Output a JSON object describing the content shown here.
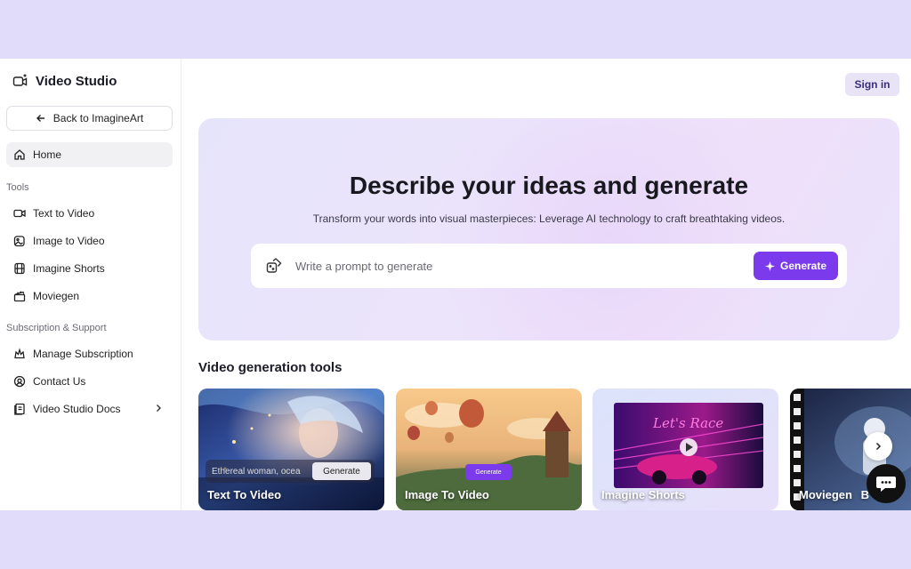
{
  "sidebar": {
    "brand": "Video Studio",
    "back_label": "Back to ImagineArt",
    "home_label": "Home",
    "tools_heading": "Tools",
    "tools": [
      {
        "label": "Text to Video",
        "icon": "video-camera-icon"
      },
      {
        "label": "Image to Video",
        "icon": "image-sparkle-icon"
      },
      {
        "label": "Imagine Shorts",
        "icon": "film-icon"
      },
      {
        "label": "Moviegen",
        "icon": "clapperboard-icon"
      }
    ],
    "support_heading": "Subscription & Support",
    "support": [
      {
        "label": "Manage Subscription",
        "icon": "crown-icon"
      },
      {
        "label": "Contact Us",
        "icon": "at-sign-icon"
      },
      {
        "label": "Video Studio Docs",
        "icon": "docs-icon"
      }
    ]
  },
  "header": {
    "signin_label": "Sign in"
  },
  "hero": {
    "title": "Describe your ideas and generate",
    "subtitle": "Transform your words into visual masterpieces: Leverage AI technology to craft breathtaking videos.",
    "prompt_placeholder": "Write a prompt to generate",
    "generate_label": "Generate"
  },
  "tools_section": {
    "title": "Video generation tools",
    "cards": [
      {
        "label": "Text To Video",
        "mini_prompt": "Ethereal woman, ocea",
        "mini_button": "Generate"
      },
      {
        "label": "Image To Video",
        "mini_button": "Generate"
      },
      {
        "label": "Imagine Shorts",
        "sign_text": "Let's Race"
      },
      {
        "label": "Moviegen",
        "extra": "B"
      }
    ]
  },
  "colors": {
    "accent": "#7c3aed",
    "page_bg": "#e1dcfa",
    "signin_bg": "#e8e3f5"
  }
}
